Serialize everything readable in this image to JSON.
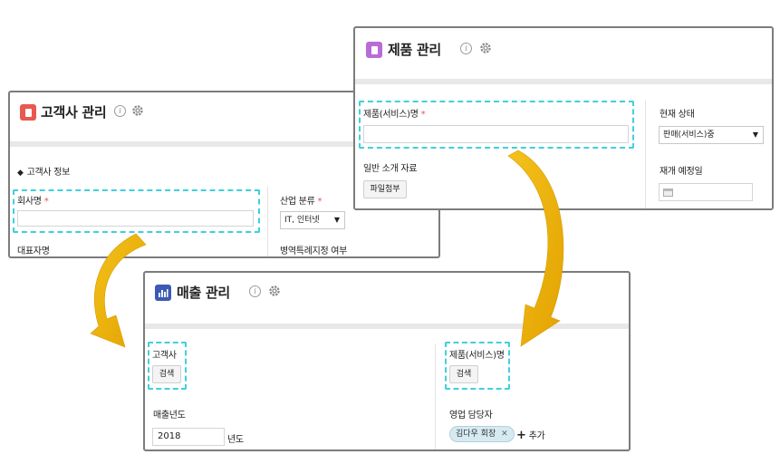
{
  "customer_window": {
    "title": "고객사 관리",
    "section_label": "고객사 정보",
    "fields": {
      "company_name": "회사명",
      "industry": "산업 분류",
      "industry_value": "IT, 인터넷",
      "representative": "대표자명",
      "military_service": "병역특례지정 여부"
    },
    "required_mark": "*",
    "accent_color": "#e8594f"
  },
  "product_window": {
    "title": "제품 관리",
    "fields": {
      "product_name": "제품(서비스)명",
      "current_status": "현재 상태",
      "status_value": "판매(서비스)중",
      "intro_material": "일반 소개 자료",
      "attach_button": "파일첨부",
      "restock_date": "재개 예정일"
    },
    "required_mark": "*",
    "accent_color": "#b96bd8"
  },
  "sales_window": {
    "title": "매출 관리",
    "fields": {
      "customer": "고객사",
      "customer_search": "검색",
      "product_name": "제품(서비스)명",
      "product_search": "검색",
      "sales_year": "매출년도",
      "sales_year_value": "2018",
      "year_suffix": "년도",
      "sales_manager": "영업 담당자",
      "manager_chip": "김다우 회장",
      "add_label": "추가"
    },
    "accent_color": "#3d5ab5"
  },
  "icons": {
    "info": "info-icon",
    "settings": "gear-icon",
    "remove": "close-icon",
    "add": "plus-icon",
    "calendar": "calendar-icon",
    "dropdown": "chevron-down-icon"
  },
  "highlight_color": "#3fd0dc",
  "arrow_color": "#f0b000"
}
